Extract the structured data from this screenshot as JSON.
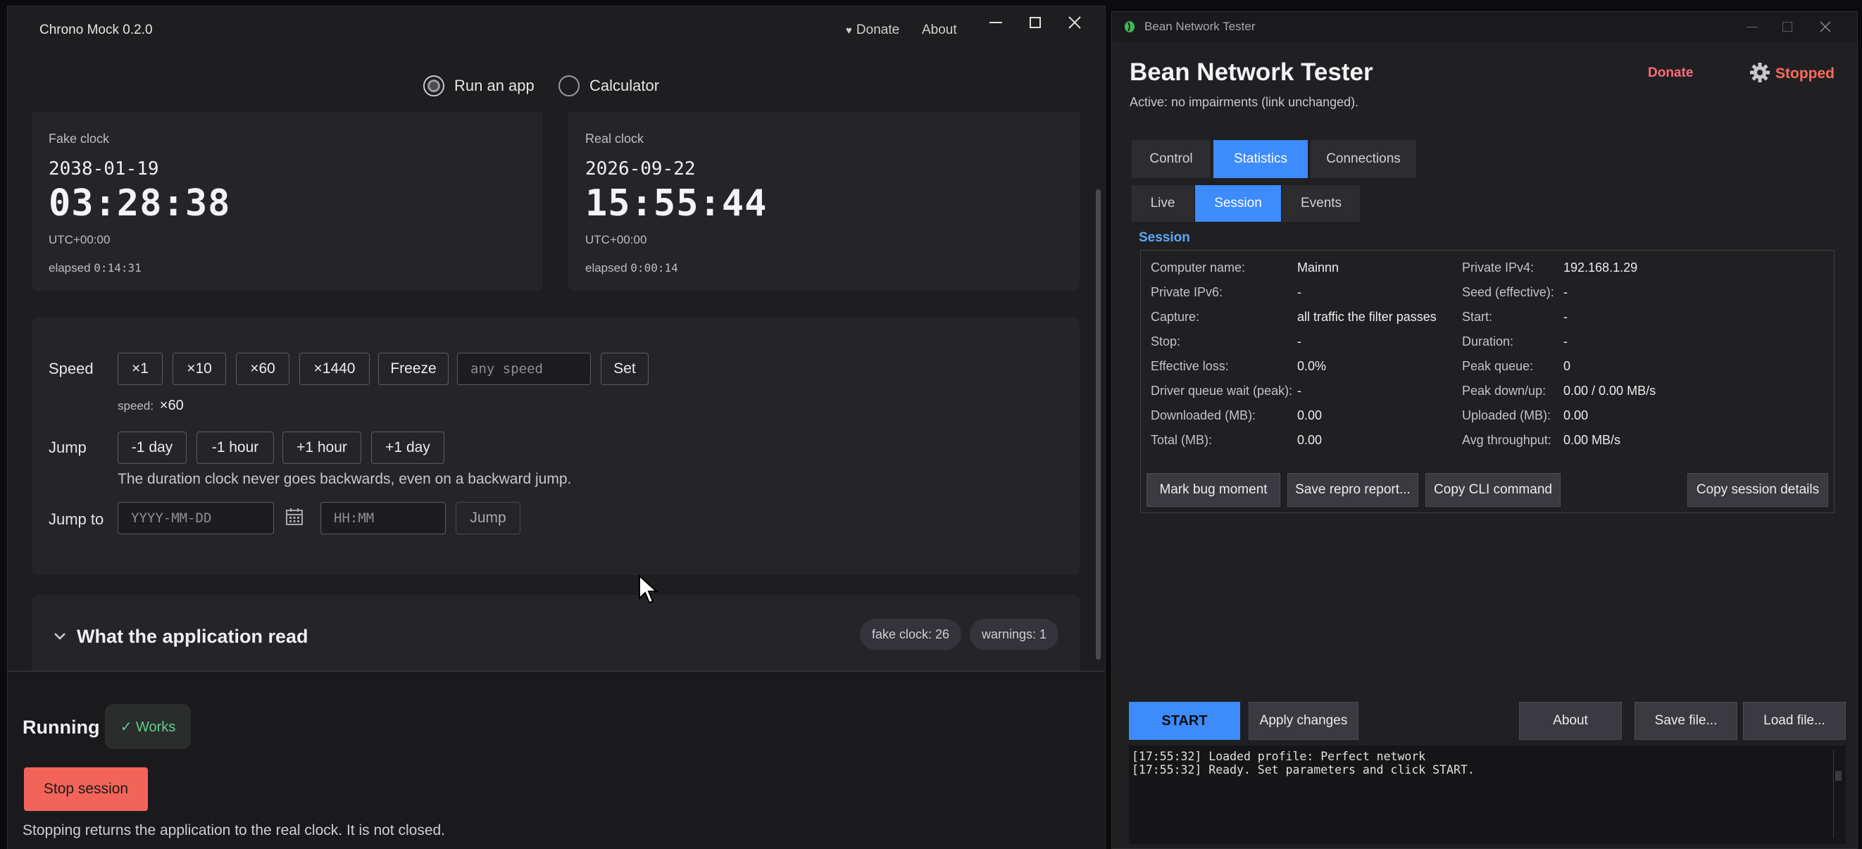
{
  "chrono": {
    "window_title": "Chrono Mock 0.2.0",
    "header": {
      "donate": "Donate",
      "about": "About"
    },
    "modes": {
      "run_app": "Run an app",
      "calculator": "Calculator"
    },
    "fake_clock": {
      "label": "Fake clock",
      "date": "2038-01-19",
      "time": "03:28:38",
      "tz": "UTC+00:00",
      "elapsed_label": "elapsed",
      "elapsed": "0:14:31"
    },
    "real_clock": {
      "label": "Real clock",
      "date": "2026-09-22",
      "time": "15:55:44",
      "tz": "UTC+00:00",
      "elapsed_label": "elapsed",
      "elapsed": "0:00:14"
    },
    "speed": {
      "label": "Speed",
      "buttons": [
        "×1",
        "×10",
        "×60",
        "×1440",
        "Freeze"
      ],
      "input_placeholder": "any speed",
      "set": "Set",
      "status_label": "speed:",
      "status_value": "×60"
    },
    "jump": {
      "label": "Jump",
      "buttons": [
        "-1 day",
        "-1 hour",
        "+1 hour",
        "+1 day"
      ],
      "note": "The duration clock never goes backwards, even on a backward jump."
    },
    "jump_to": {
      "label": "Jump to",
      "date_placeholder": "YYYY-MM-DD",
      "time_placeholder": "HH:MM",
      "button": "Jump"
    },
    "app_read": {
      "title": "What the application read",
      "fake_clock_pill": "fake clock: 26",
      "warnings_pill": "warnings: 1"
    },
    "running": {
      "label": "Running",
      "badge": "✓ Works",
      "stop": "Stop session",
      "note": "Stopping returns the application to the real clock. It is not closed."
    },
    "colors": {
      "stop_button": "#f2645a",
      "works_badge_text": "#5fd08a"
    }
  },
  "bean": {
    "window_title": "Bean Network Tester",
    "app_title": "Bean Network Tester",
    "subtitle": "Active: no impairments (link unchanged).",
    "donate": "Donate",
    "status": "Stopped",
    "tabs": [
      "Control",
      "Statistics",
      "Connections"
    ],
    "subtabs": [
      "Live",
      "Session",
      "Events"
    ],
    "section": "Session",
    "left_rows": [
      {
        "label": "Computer name:",
        "value": "Mainnn"
      },
      {
        "label": "Private IPv6:",
        "value": "-"
      },
      {
        "label": "Capture:",
        "value": "all traffic the filter passes"
      },
      {
        "label": "Stop:",
        "value": "-"
      },
      {
        "label": "Effective loss:",
        "value": "0.0%"
      },
      {
        "label": "Driver queue wait (peak):",
        "value": "-"
      },
      {
        "label": "Downloaded (MB):",
        "value": "0.00"
      },
      {
        "label": "Total (MB):",
        "value": "0.00"
      }
    ],
    "right_rows": [
      {
        "label": "Private IPv4:",
        "value": "192.168.1.29"
      },
      {
        "label": "Seed (effective):",
        "value": "-"
      },
      {
        "label": "Start:",
        "value": "-"
      },
      {
        "label": "Duration:",
        "value": "-"
      },
      {
        "label": "Peak queue:",
        "value": "0"
      },
      {
        "label": "Peak down/up:",
        "value": "0.00 / 0.00 MB/s"
      },
      {
        "label": "Uploaded (MB):",
        "value": "0.00"
      },
      {
        "label": "Avg throughput:",
        "value": "0.00 MB/s"
      }
    ],
    "session_buttons": [
      "Mark bug moment",
      "Save repro report...",
      "Copy CLI command",
      "Copy session details"
    ],
    "bottom_buttons": {
      "start": "START",
      "apply": "Apply changes",
      "about": "About",
      "save": "Save file...",
      "load": "Load file..."
    },
    "log": [
      "[17:55:32] Loaded profile: Perfect network",
      "[17:55:32] Ready. Set parameters and click START."
    ],
    "colors": {
      "accent": "#3d8bfd",
      "status_stopped": "#ff6b5b",
      "donate": "#ff6b7a",
      "section": "#5aa8ff"
    }
  }
}
